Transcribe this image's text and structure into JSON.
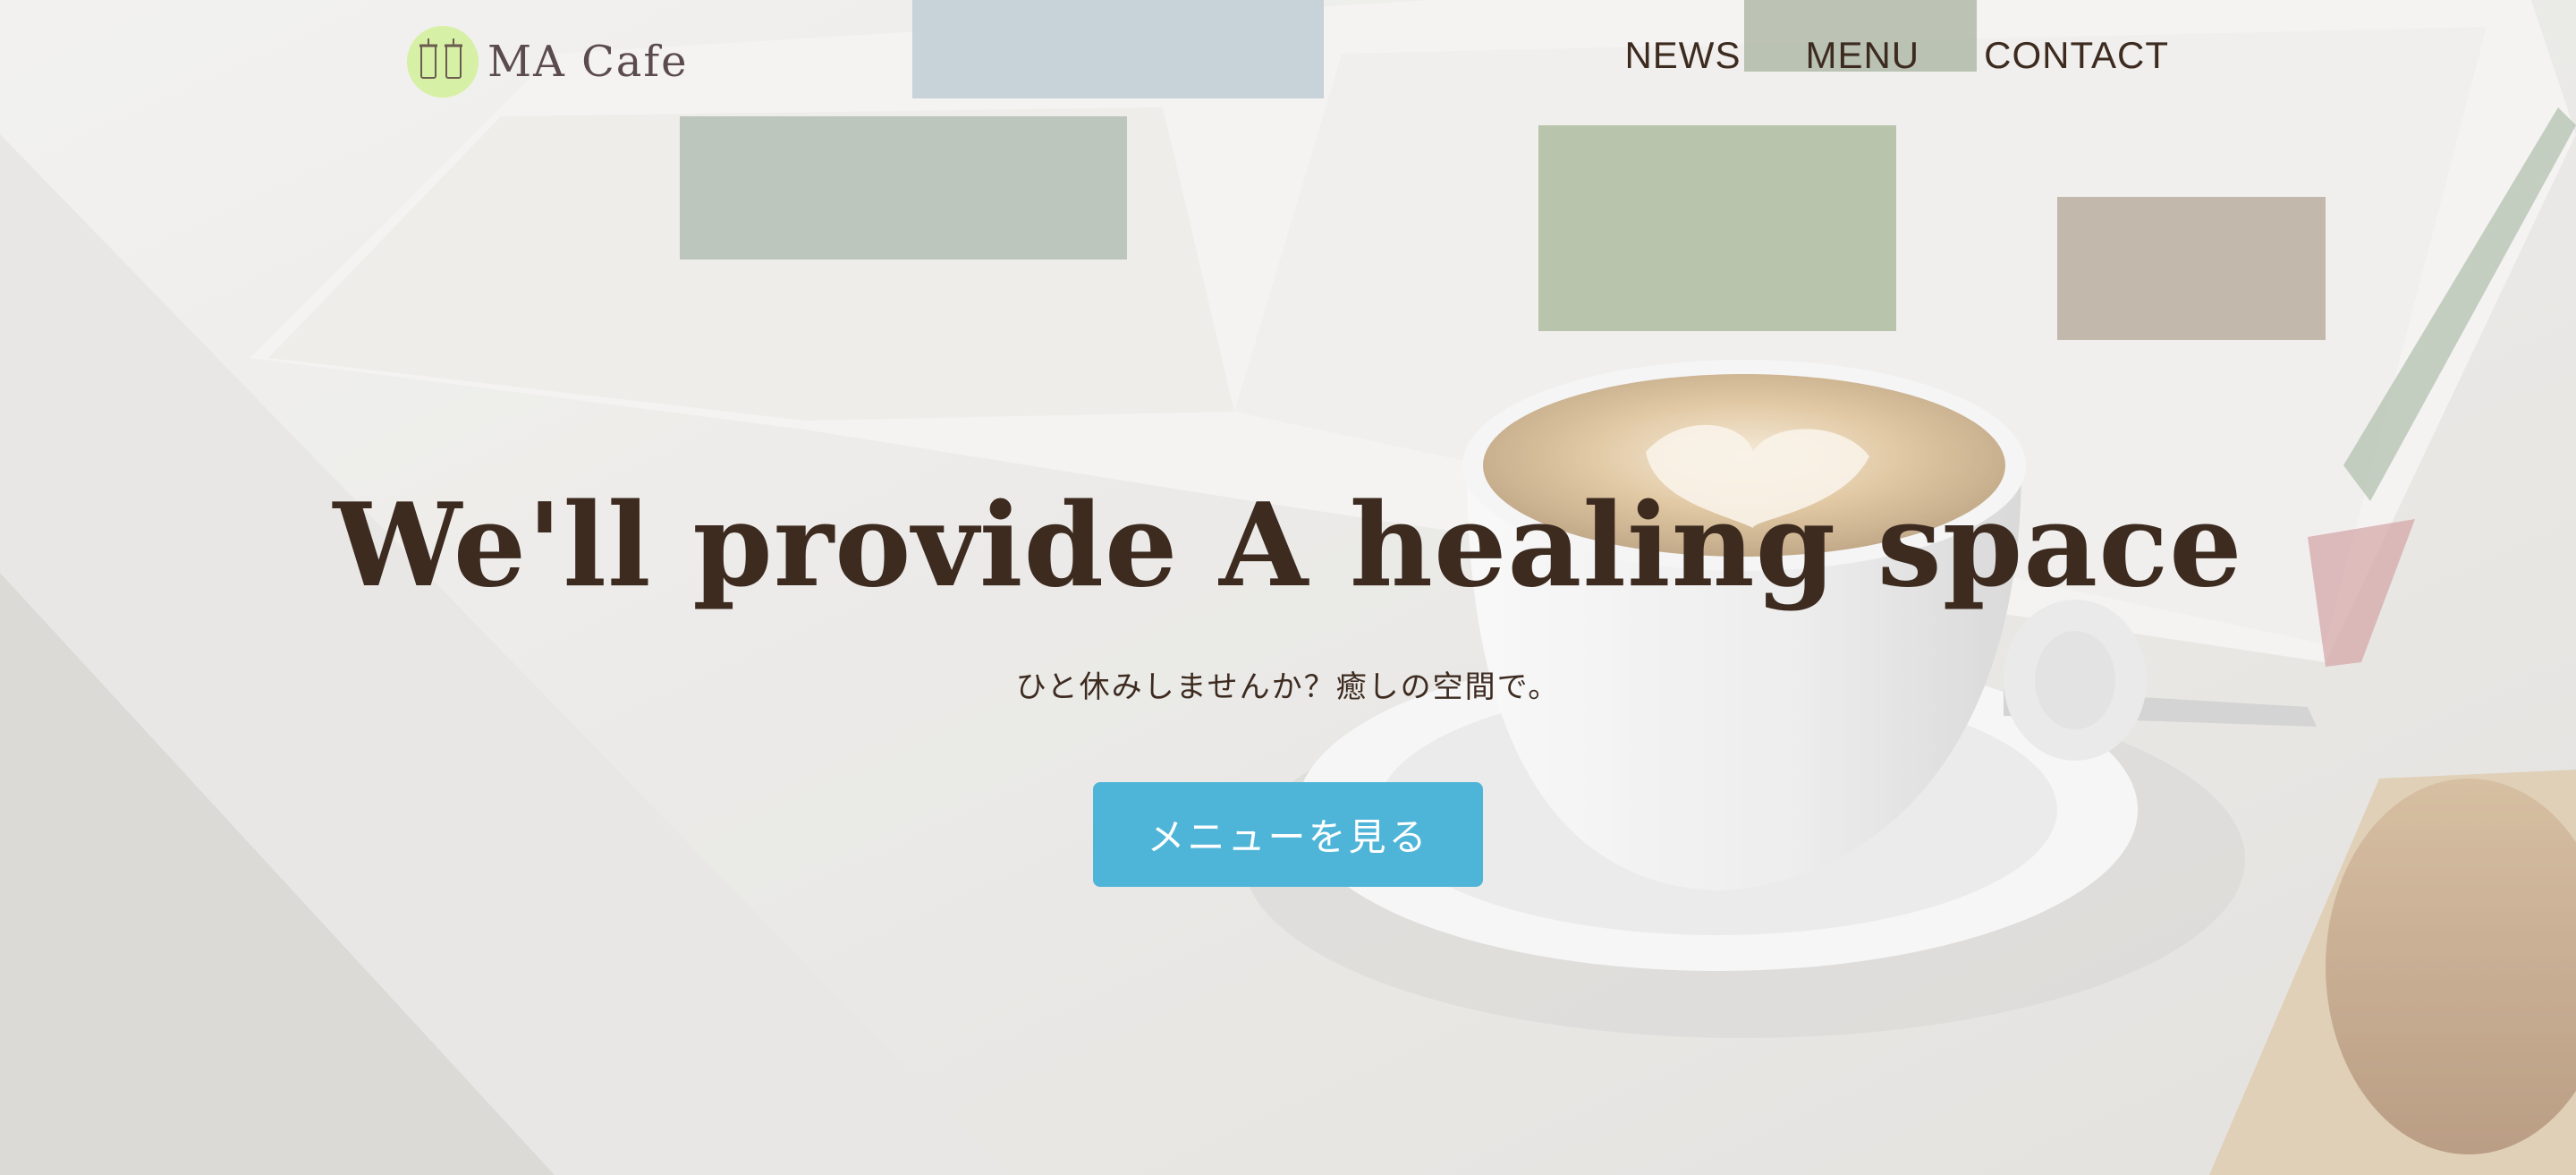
{
  "header": {
    "logo_text": "MA Cafe",
    "nav": [
      {
        "label": "NEWS"
      },
      {
        "label": "MENU"
      },
      {
        "label": "CONTACT"
      }
    ]
  },
  "hero": {
    "title": "We'll provide A healing space",
    "subtitle": "ひと休みしませんか？癒しの空間で。",
    "cta_label": "メニューを見る",
    "background": "photo-coffee-cup-magazine",
    "logo_icon": "cafe-logo-icon"
  },
  "colors": {
    "text": "#3d2b20",
    "logo_text": "#5b4b4e",
    "logo_circle": "#d6f0a6",
    "cta": "#4fb5d8",
    "cta_text": "#ffffff"
  }
}
